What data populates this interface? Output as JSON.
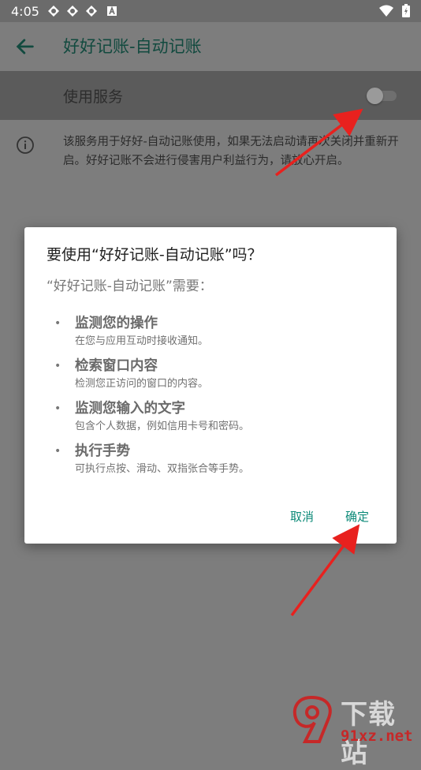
{
  "status_bar": {
    "time": "4:05",
    "notification_icons": [
      "app-notification-icon",
      "app-notification-icon",
      "app-notification-icon",
      "a-badge-icon"
    ],
    "system_icons": [
      "wifi-icon",
      "battery-icon"
    ]
  },
  "toolbar": {
    "title": "好好记账-自动记账",
    "back_icon": "arrow-left-icon"
  },
  "service": {
    "label": "使用服务",
    "toggle_on": false
  },
  "info": {
    "icon": "info-icon",
    "text": "该服务用于好好-自动记账使用，如果无法启动请再次关闭并重新开启。好好记账不会进行侵害用户利益行为，请放心开启。"
  },
  "dialog": {
    "title": "要使用“好好记账-自动记账”吗？",
    "subtitle": "“好好记账-自动记账”需要：",
    "permissions": [
      {
        "title": "监测您的操作",
        "desc": "在您与应用互动时接收通知。"
      },
      {
        "title": "检索窗口内容",
        "desc": "检测您正访问的窗口的内容。"
      },
      {
        "title": "监测您输入的文字",
        "desc": "包含个人数据，例如信用卡号和密码。"
      },
      {
        "title": "执行手势",
        "desc": "可执行点按、滑动、双指张合等手势。"
      }
    ],
    "cancel_label": "取消",
    "ok_label": "确定"
  },
  "watermark": {
    "brand": "下载站",
    "domain": "91xz.net"
  },
  "colors": {
    "accent": "#0c8a78",
    "annotation_arrow": "#e8211e"
  }
}
